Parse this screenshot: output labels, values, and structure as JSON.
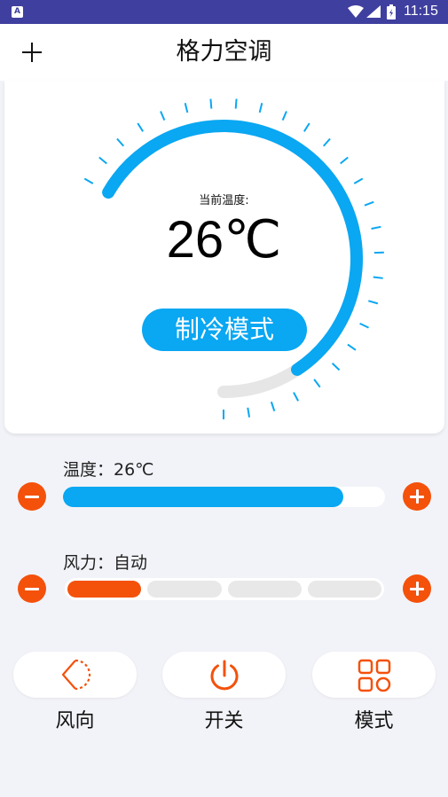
{
  "status_bar": {
    "time": "11:15"
  },
  "header": {
    "title": "格力空调"
  },
  "gauge": {
    "current_label": "当前温度:",
    "current_temp": "26℃",
    "mode": "制冷模式",
    "arc_fraction": 0.86,
    "accent_color": "#0aa7f2",
    "track_color": "#e6e6e6"
  },
  "temperature": {
    "label": "温度：26℃",
    "fraction": 0.87
  },
  "wind": {
    "label": "风力：自动",
    "level": 1,
    "levels": 4
  },
  "actions": [
    {
      "label": "风向",
      "icon": "wind-direction-icon"
    },
    {
      "label": "开关",
      "icon": "power-icon"
    },
    {
      "label": "模式",
      "icon": "mode-grid-icon"
    }
  ],
  "colors": {
    "accent_orange": "#f4510b",
    "accent_blue": "#0aa7f2",
    "status_bar": "#3f3f9f"
  }
}
